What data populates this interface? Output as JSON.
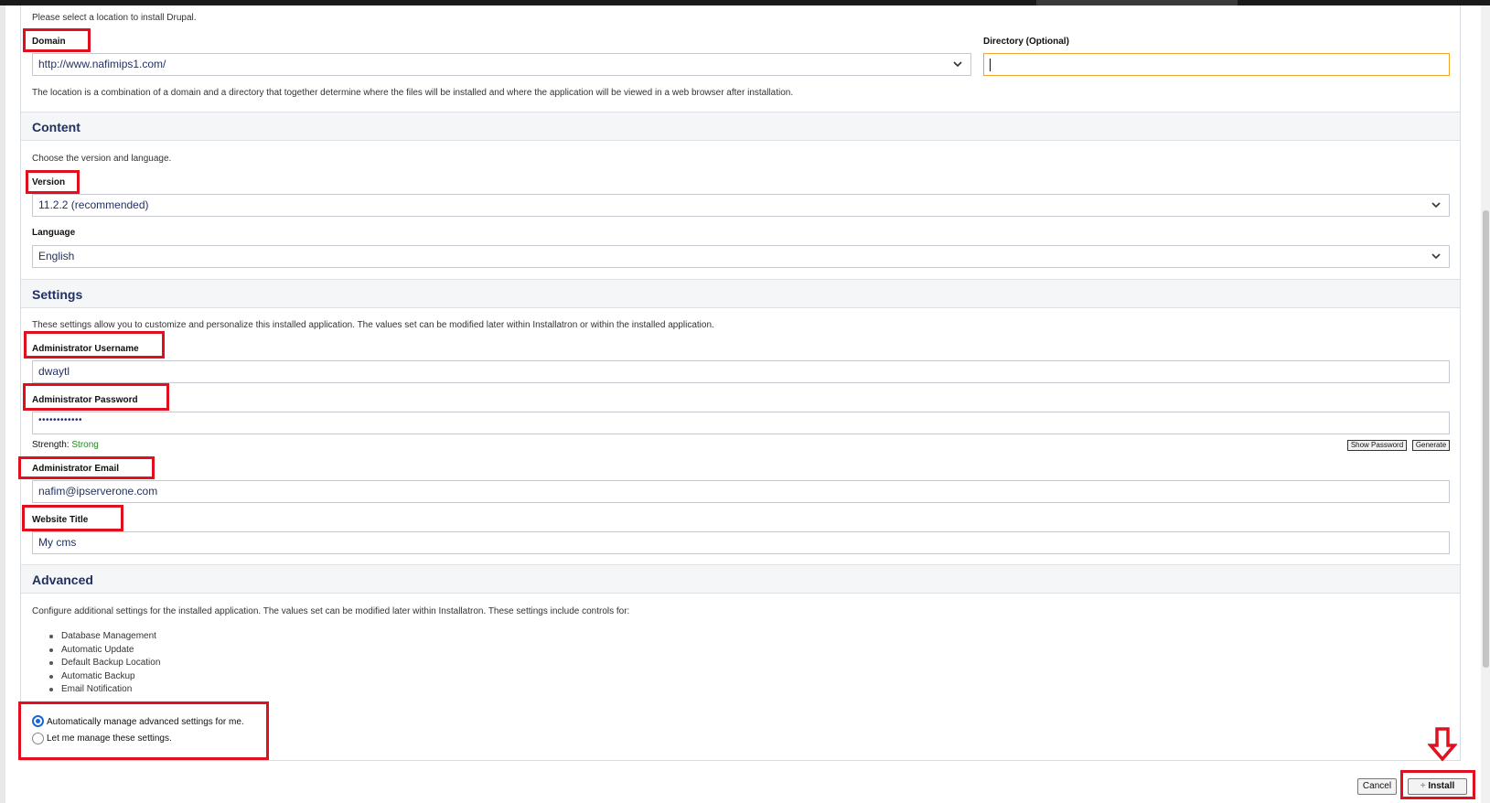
{
  "location": {
    "intro": "Please select a location to install Drupal.",
    "domain_label": "Domain",
    "domain_value": "http://www.nafimips1.com/",
    "directory_label": "Directory (Optional)",
    "directory_value": "",
    "note": "The location is a combination of a domain and a directory that together determine where the files will be installed and where the application will be viewed in a web browser after installation."
  },
  "content": {
    "title": "Content",
    "intro": "Choose the version and language.",
    "version_label": "Version",
    "version_value": "11.2.2 (recommended)",
    "language_label": "Language",
    "language_value": "English"
  },
  "settings": {
    "title": "Settings",
    "intro": "These settings allow you to customize and personalize this installed application. The values set can be modified later within Installatron or within the installed application.",
    "username_label": "Administrator Username",
    "username_value": "dwaytl",
    "password_label": "Administrator Password",
    "password_value": "••••••••••••",
    "strength_label": "Strength:",
    "strength_value": "Strong",
    "show_password": "Show Password",
    "generate": "Generate",
    "email_label": "Administrator Email",
    "email_value": "nafim@ipserverone.com",
    "title_label": "Website Title",
    "title_value": "My cms"
  },
  "advanced": {
    "title": "Advanced",
    "intro": "Configure additional settings for the installed application. The values set can be modified later within Installatron. These settings include controls for:",
    "items": [
      "Database Management",
      "Automatic Update",
      "Default Backup Location",
      "Automatic Backup",
      "Email Notification"
    ],
    "option_auto": "Automatically manage advanced settings for me.",
    "option_manual": "Let me manage these settings."
  },
  "actions": {
    "cancel": "Cancel",
    "install": "Install"
  },
  "colors": {
    "highlight": "#e0101e",
    "strength": "#1e8a1e",
    "accent": "#1a66d9",
    "directory_focus": "#f0a52a"
  }
}
